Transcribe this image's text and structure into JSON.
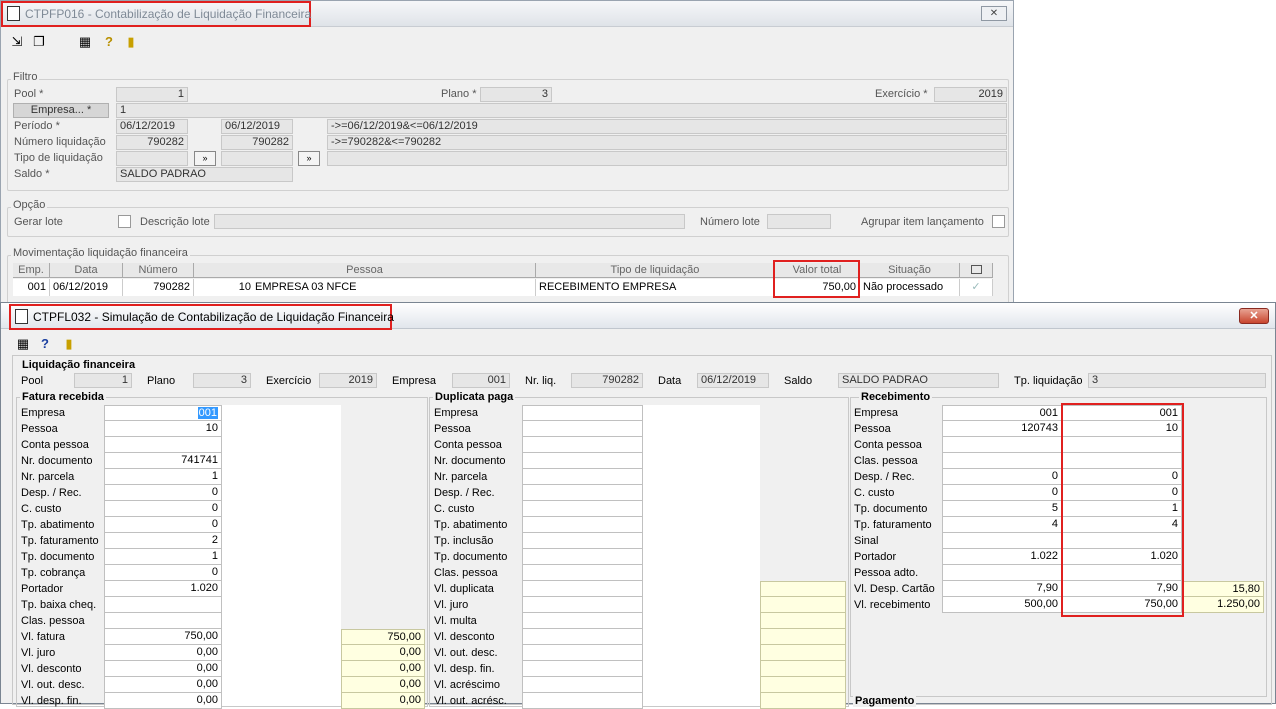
{
  "win1": {
    "title": "CTPFP016 - Contabilização de Liquidação Financeira",
    "close_label": "✕",
    "filtro": {
      "label": "Filtro",
      "pool_label": "Pool *",
      "pool_value": "1",
      "plano_label": "Plano *",
      "plano_value": "3",
      "exercicio_label": "Exercício *",
      "exercicio_value": "2019",
      "empresa_button": "Empresa... *",
      "empresa_value": "1",
      "periodo_label": "Período *",
      "periodo_from": "06/12/2019",
      "periodo_to": "06/12/2019",
      "periodo_expr": "->=06/12/2019&<=06/12/2019",
      "numero_label": "Número liquidação",
      "numero_from": "790282",
      "numero_to": "790282",
      "numero_expr": "->=790282&<=790282",
      "tipo_label": "Tipo de liquidação",
      "saldo_label": "Saldo *",
      "saldo_value": "SALDO PADRAO"
    },
    "opcao": {
      "label": "Opção",
      "gerar_lote": "Gerar lote",
      "descricao_lote": "Descrição lote",
      "numero_lote": "Número lote",
      "agrupar": "Agrupar item lançamento"
    },
    "mov": {
      "label": "Movimentação liquidação financeira",
      "headers": [
        "Emp.",
        "Data",
        "Número",
        "Pessoa",
        "Tipo de liquidação",
        "Valor total",
        "Situação"
      ],
      "row": {
        "emp": "001",
        "data": "06/12/2019",
        "numero": "790282",
        "pessoa_cod": "10",
        "pessoa": "EMPRESA 03 NFCE",
        "tipo": "RECEBIMENTO EMPRESA",
        "valor": "750,00",
        "situacao": "Não processado"
      }
    }
  },
  "win2": {
    "title": "CTPFL032 - Simulação de Contabilização de Liquidação Financeira",
    "close_label": "✕",
    "liq": {
      "label": "Liquidação financeira",
      "pool_label": "Pool",
      "pool": "1",
      "plano_label": "Plano",
      "plano": "3",
      "exercicio_label": "Exercício",
      "exercicio": "2019",
      "empresa_label": "Empresa",
      "empresa": "001",
      "nrliq_label": "Nr. liq.",
      "nrliq": "790282",
      "data_label": "Data",
      "data": "06/12/2019",
      "saldo_label": "Saldo",
      "saldo": "SALDO PADRAO",
      "tpliq_label": "Tp. liquidação",
      "tpliq": "3"
    },
    "fatura": {
      "label": "Fatura recebida",
      "rows": [
        {
          "l": "Empresa",
          "v": "001",
          "y": ""
        },
        {
          "l": "Pessoa",
          "v": "10",
          "y": ""
        },
        {
          "l": "Conta pessoa",
          "v": "",
          "y": ""
        },
        {
          "l": "Nr. documento",
          "v": "741741",
          "y": ""
        },
        {
          "l": "Nr. parcela",
          "v": "1",
          "y": ""
        },
        {
          "l": "Desp. / Rec.",
          "v": "0",
          "y": ""
        },
        {
          "l": "C. custo",
          "v": "0",
          "y": ""
        },
        {
          "l": "Tp. abatimento",
          "v": "0",
          "y": ""
        },
        {
          "l": "Tp. faturamento",
          "v": "2",
          "y": ""
        },
        {
          "l": "Tp. documento",
          "v": "1",
          "y": ""
        },
        {
          "l": "Tp. cobrança",
          "v": "0",
          "y": ""
        },
        {
          "l": "Portador",
          "v": "1.020",
          "y": ""
        },
        {
          "l": "Tp. baixa cheq.",
          "v": "",
          "y": ""
        },
        {
          "l": "Clas. pessoa",
          "v": "",
          "y": ""
        },
        {
          "l": "Vl. fatura",
          "v": "750,00",
          "y": "750,00"
        },
        {
          "l": "Vl. juro",
          "v": "0,00",
          "y": "0,00"
        },
        {
          "l": "Vl. desconto",
          "v": "0,00",
          "y": "0,00"
        },
        {
          "l": "Vl. out. desc.",
          "v": "0,00",
          "y": "0,00"
        },
        {
          "l": "Vl. desp. fin.",
          "v": "0,00",
          "y": "0,00"
        }
      ]
    },
    "duplicata": {
      "label": "Duplicata paga",
      "rows": [
        "Empresa",
        "Pessoa",
        "Conta pessoa",
        "Nr. documento",
        "Nr. parcela",
        "Desp. / Rec.",
        "C. custo",
        "Tp. abatimento",
        "Tp. inclusão",
        "Tp. documento",
        "Clas. pessoa",
        "Vl. duplicata",
        "Vl. juro",
        "Vl. multa",
        "Vl. desconto",
        "Vl. out. desc.",
        "Vl. desp. fin.",
        "Vl. acréscimo",
        "Vl. out. acrésc."
      ]
    },
    "recebimento": {
      "label": "Recebimento",
      "rows": [
        {
          "l": "Empresa",
          "a": "001",
          "b": "001",
          "c": ""
        },
        {
          "l": "Pessoa",
          "a": "120743",
          "b": "10",
          "c": ""
        },
        {
          "l": "Conta pessoa",
          "a": "",
          "b": "",
          "c": ""
        },
        {
          "l": "Clas. pessoa",
          "a": "",
          "b": "",
          "c": ""
        },
        {
          "l": "Desp. / Rec.",
          "a": "0",
          "b": "0",
          "c": ""
        },
        {
          "l": "C. custo",
          "a": "0",
          "b": "0",
          "c": ""
        },
        {
          "l": "Tp. documento",
          "a": "5",
          "b": "1",
          "c": ""
        },
        {
          "l": "Tp. faturamento",
          "a": "4",
          "b": "4",
          "c": ""
        },
        {
          "l": "Sinal",
          "a": "",
          "b": "",
          "c": ""
        },
        {
          "l": "Portador",
          "a": "1.022",
          "b": "1.020",
          "c": ""
        },
        {
          "l": "Pessoa adto.",
          "a": "",
          "b": "",
          "c": ""
        },
        {
          "l": "Vl. Desp. Cartão",
          "a": "7,90",
          "b": "7,90",
          "c": "15,80"
        },
        {
          "l": "Vl. recebimento",
          "a": "500,00",
          "b": "750,00",
          "c": "1.250,00"
        }
      ],
      "pagamento_label": "Pagamento"
    }
  }
}
